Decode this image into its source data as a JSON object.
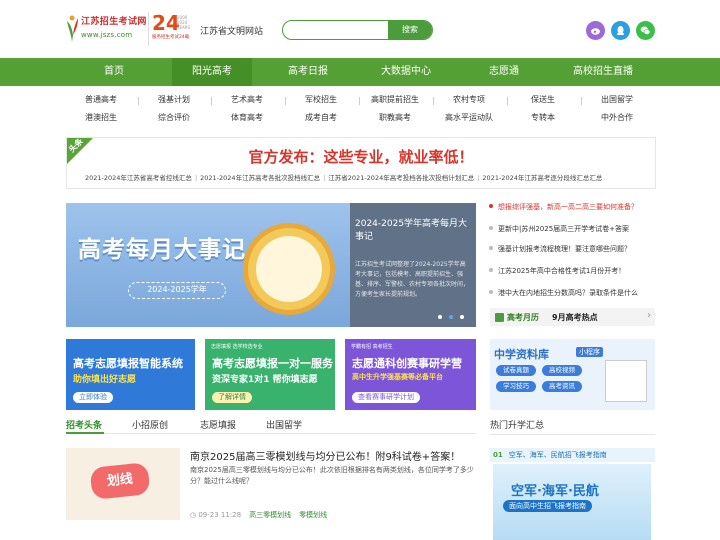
{
  "header": {
    "logo_name": "江苏招生考试网",
    "logo_url": "www.jszs.com",
    "logo_years": "24",
    "logo_years_side": "2000 2024 YEARS",
    "logo_caption": "服务招生考试24载",
    "civilization": "江苏省文明网站",
    "search_placeholder": "",
    "search_button": "搜索",
    "social_icons": [
      "weibo-icon",
      "qq-icon",
      "wechat-icon"
    ]
  },
  "nav": {
    "items": [
      "首页",
      "阳光高考",
      "高考日报",
      "大数据中心",
      "志愿通",
      "高校招生直播"
    ],
    "active": "阳光高考"
  },
  "subnav": {
    "row1": [
      "普通高考",
      "强基计划",
      "艺术高考",
      "军校招生",
      "高职提前招生",
      "农村专项",
      "保送生",
      "出国留学"
    ],
    "row2": [
      "港澳招生",
      "综合评价",
      "体育高考",
      "成考自考",
      "职教高考",
      "高水平运动队",
      "专转本",
      "中外合作"
    ]
  },
  "headline": {
    "tag": "头条",
    "title": "官方发布：这些专业，就业率低！",
    "links": [
      "2021-2024年江苏省高考省控线汇总",
      "2021-2024年江苏高考各批次投档线汇总",
      "江苏省2021-2024年高考投档各批次投档计划汇总",
      "2021-2024年江苏高考逐分段线汇总汇总"
    ]
  },
  "banner": {
    "image_title": "高考每月大事记",
    "image_pill": "2024-2025学年",
    "side_title": "2024-2025学年高考每月大事记",
    "side_desc": "江苏招生考试网整理了2024-2025学年高考大事记，包括模考、高职提前招生、强基、排序、军警校、农村专项各批次时间，方便考生家长提前规划。"
  },
  "news": {
    "first": "想报综评强基，新高一高二高三要如何准备？",
    "items": [
      "更新中|苏州2025届高三开学考试卷+答案",
      "强基计划报考流程梳理！要注意哪些问题？",
      "江苏2025年高中合格性考试1月份开考！",
      "港中大在内地招生分数高吗？录取条件是什么"
    ]
  },
  "calendar": {
    "label": "高考月历",
    "text": "9月高考热点"
  },
  "cards": [
    {
      "small": "",
      "title": "高考志愿填报智能系统",
      "subtitle": "助你填出好志愿",
      "button": "立即体验",
      "color": "#2f7ad8",
      "sub_color": "#ffe24a",
      "btn_bg": "#ffffff",
      "btn_color": "#2f7ad8"
    },
    {
      "small": "志愿填报 选学校选专业",
      "title": "高考志愿填报一对一服务",
      "subtitle": "资深专家1对1 帮你填志愿",
      "button": "了解详情",
      "color": "#38b26c",
      "sub_color": "#ffffff",
      "btn_bg": "#fff2b0",
      "btn_color": "#2a8a4e"
    },
    {
      "small": "学霸有招 高考招生",
      "title": "志愿通科创赛事研学营",
      "subtitle": "高中生升学强基赛等必备平台",
      "button": "查看赛事研学计划",
      "color": "#7c55d8",
      "sub_color": "#ffe24a",
      "btn_bg": "#ffffff",
      "btn_color": "#7c55d8"
    }
  ],
  "card4": {
    "title": "中学资料库",
    "badge": "小程序",
    "buttons": [
      "试卷真题",
      "高校视频",
      "学习技巧",
      "高考资讯"
    ]
  },
  "tabs": {
    "items": [
      "招考头条",
      "小招原创",
      "志愿填报",
      "出国留学"
    ],
    "active": "招考头条"
  },
  "article": {
    "image_label": "划线",
    "title": "南京2025届高三零模划线与均分已公布！附9科试卷+答案！",
    "desc": "南京2025届高三零模划线与均分已公布！此次依旧根据排名有两类划线，各位同学考了多少分？能过什么线呢？",
    "date": "09-23 11:28",
    "tags": [
      "高三零模划线",
      "零模划线"
    ]
  },
  "hot": {
    "title": "热门升学汇总",
    "item_num": "01",
    "item_text": "空军、海军、民航招飞报考指南",
    "image_title": "空军·海军·民航",
    "image_sub": "面向高中生招飞报考指南"
  },
  "colors": {
    "brand_green": "#55a035",
    "headline_red": "#d9342b",
    "link_blue": "#1e6fb0"
  }
}
